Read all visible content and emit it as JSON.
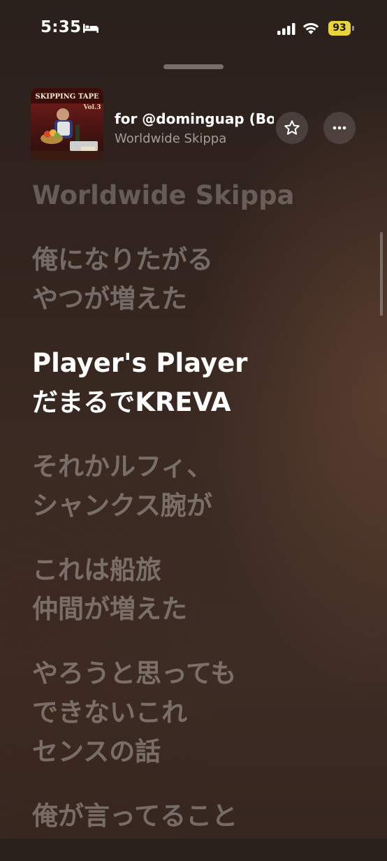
{
  "status_bar": {
    "time": "5:35",
    "focus_icon": "bed-icon",
    "signal_icon": "cellular-signal-icon",
    "wifi_icon": "wifi-icon",
    "battery_level": "93",
    "battery_color": "#e8d33a"
  },
  "now_playing": {
    "artwork_text": "SKIPPING TAPE Vol.3",
    "title": "for @dominguap (Bo",
    "artist": "Worldwide Skippa",
    "favorite_icon": "star-icon",
    "more_icon": "ellipsis-icon"
  },
  "lyrics": [
    {
      "text": "Worldwide Skippa",
      "state": "past"
    },
    {
      "text": "俺になりたがる\nやつが増えた",
      "state": "upcoming"
    },
    {
      "text": "Player's Player\nだまるでKREVA",
      "state": "active"
    },
    {
      "text": "それかルフィ、\nシャンクス腕が",
      "state": "upcoming"
    },
    {
      "text": "これは船旅\n仲間が増えた",
      "state": "upcoming"
    },
    {
      "text": "やろうと思っても\nできないこれ\nセンスの話",
      "state": "upcoming"
    },
    {
      "text": "俺が言ってること",
      "state": "upcoming"
    }
  ]
}
